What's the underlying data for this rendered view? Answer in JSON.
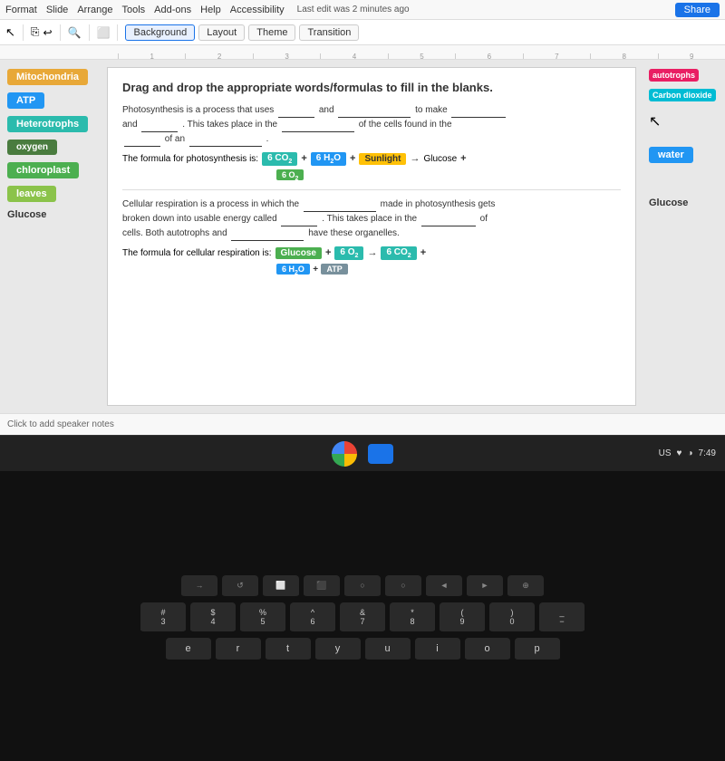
{
  "menubar": {
    "items": [
      "Format",
      "Slide",
      "Arrange",
      "Tools",
      "Add-ons",
      "Help",
      "Accessibility"
    ],
    "last_edit": "Last edit was 2 minutes ago",
    "share_label": "Share"
  },
  "toolbar": {
    "background_label": "Background",
    "layout_label": "Layout",
    "theme_label": "Theme",
    "transition_label": "Transition"
  },
  "slide": {
    "title": "Drag and drop the appropriate words/formulas to fill in the blanks.",
    "photosynthesis_text1": "Photosynthesis is a process that uses",
    "photosynthesis_text2": "and",
    "photosynthesis_text3": "to make",
    "photosynthesis_text4": "and",
    "photosynthesis_text5": ". This takes place in the",
    "photosynthesis_text6": "of the cells found in the",
    "photosynthesis_text7": "of an",
    "photosynthesis_formula_label": "The formula for photosynthesis is:",
    "cellular_text1": "Cellular respiration is a process in which the",
    "cellular_text2": "made in photosynthesis gets broken down into usable energy called",
    "cellular_text3": ". This takes place in the",
    "cellular_text4": "of cells. Both autotrophs and",
    "cellular_text5": "have these organelles.",
    "cellular_formula_label": "The formula for cellular respiration is:"
  },
  "left_tiles": [
    {
      "label": "Mitochondria",
      "color": "tile-orange"
    },
    {
      "label": "ATP",
      "color": "tile-blue"
    },
    {
      "label": "Heterotrophs",
      "color": "tile-teal"
    },
    {
      "label": "oxygen",
      "color": "tile-green-dark"
    },
    {
      "label": "chloroplast",
      "color": "tile-green"
    },
    {
      "label": "leaves",
      "color": "tile-lime"
    },
    {
      "label": "Glucose",
      "color": "tile-gray"
    }
  ],
  "right_tiles": [
    {
      "label": "autotrophs",
      "color": "tile-pink"
    },
    {
      "label": "Carbon dioxide",
      "color": "tile-cyan"
    },
    {
      "label": "water",
      "color": "tile-blue"
    }
  ],
  "right_label": "Glucose",
  "formula_photo": {
    "co2": "6 CO₂",
    "plus1": "+",
    "h2o": "6 H₂O",
    "plus2": "+",
    "sunlight": "Sunlight",
    "arrow": "→",
    "glucose": "Glucose",
    "plus3": "+",
    "co2_sub": "6 O₂"
  },
  "formula_cellular": {
    "glucose": "Glucose",
    "plus1": "+",
    "o2": "6 O₂",
    "arrow": "→",
    "co2": "6 CO₂",
    "plus2": "+",
    "h2o_sub": "6 H₂O",
    "plus3": "+",
    "atp": "ATP"
  },
  "status_bar": {
    "label": "Click to add speaker notes"
  },
  "taskbar": {
    "time": "7:49",
    "sys_icons": "US ♥ ◑"
  },
  "keyboard": {
    "row1": [
      "→",
      "↺",
      "⬜",
      "⬛",
      "○",
      "○",
      "◄",
      "►",
      "⊕"
    ],
    "row2": [
      "#\n3",
      "$\n4",
      "%\n5",
      "^\n6",
      "&\n7",
      "*\n8",
      "(\n9",
      ")\n0",
      "−"
    ],
    "row3": [
      "e",
      "r",
      "t",
      "y",
      "u",
      "i",
      "o",
      "p"
    ],
    "row4": []
  }
}
